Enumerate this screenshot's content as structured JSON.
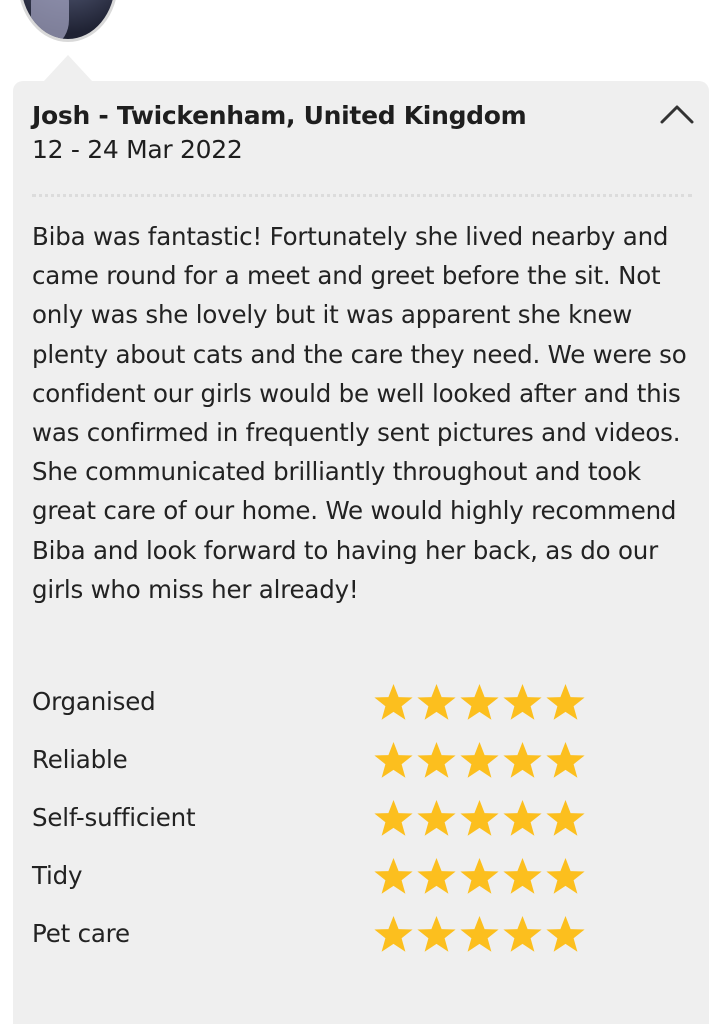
{
  "review": {
    "reviewer": "Josh - Twickenham, United Kingdom",
    "dates": "12 - 24 Mar 2022",
    "collapse_icon": "chevron-up-icon",
    "text": "Biba was fantastic! Fortunately she lived nearby and came round for a meet and greet before the sit. Not only was she lovely but it was apparent she knew plenty about cats and the care they need. We were so confident our girls would be well looked after and this was confirmed in frequently sent pictures and videos. She communicated brilliantly throughout and took great care of our home. We would highly recommend Biba and look forward to having her back, as do our girls who miss her already!"
  },
  "ratings": [
    {
      "label": "Organised",
      "stars": 5,
      "max": 5
    },
    {
      "label": "Reliable",
      "stars": 5,
      "max": 5
    },
    {
      "label": "Self-sufficient",
      "stars": 5,
      "max": 5
    },
    {
      "label": "Tidy",
      "stars": 5,
      "max": 5
    },
    {
      "label": "Pet care",
      "stars": 5,
      "max": 5
    }
  ],
  "colors": {
    "card_background": "#efefef",
    "star": "#fcbf1e",
    "text": "#222222"
  }
}
